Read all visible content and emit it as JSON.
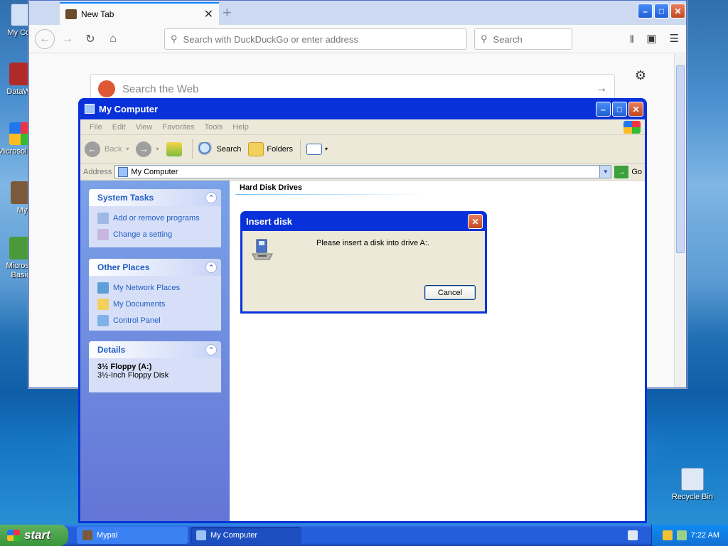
{
  "desktop": {
    "icons": [
      {
        "label": "My Com"
      },
      {
        "label": "DataWa"
      },
      {
        "label": "Microsol C++"
      },
      {
        "label": "My"
      },
      {
        "label": "Microsol Basic"
      },
      {
        "label": "Recycle Bin"
      }
    ]
  },
  "firefox": {
    "tab_title": "New Tab",
    "url_placeholder": "Search with DuckDuckGo or enter address",
    "search_placeholder": "Search",
    "ddg_placeholder": "Search the Web"
  },
  "mycomputer": {
    "title": "My Computer",
    "menu": [
      "File",
      "Edit",
      "View",
      "Favorites",
      "Tools",
      "Help"
    ],
    "toolbar": {
      "back": "Back",
      "search": "Search",
      "folders": "Folders"
    },
    "address_label": "Address",
    "address_value": "My Computer",
    "go_label": "Go",
    "system_tasks": {
      "title": "System Tasks",
      "items": [
        "Add or remove programs",
        "Change a setting"
      ]
    },
    "other_places": {
      "title": "Other Places",
      "items": [
        "My Network Places",
        "My Documents",
        "Control Panel"
      ]
    },
    "details": {
      "title": "Details",
      "name": "3½ Floppy (A:)",
      "desc": "3½-Inch Floppy Disk"
    },
    "section_header": "Hard Disk Drives"
  },
  "dialog": {
    "title": "Insert disk",
    "message": "Please insert a disk into drive A:.",
    "cancel": "Cancel"
  },
  "taskbar": {
    "start": "start",
    "tasks": [
      "Mypal",
      "My Computer"
    ],
    "time": "7:22 AM"
  }
}
